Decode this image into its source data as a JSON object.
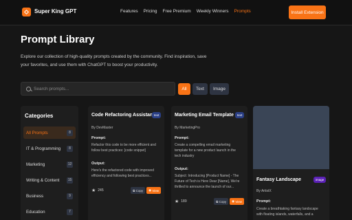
{
  "header": {
    "brand": "Super King GPT",
    "nav": [
      "Features",
      "Pricing",
      "Free Premium",
      "Weekly Winners",
      "Prompts"
    ],
    "active_nav": "Prompts",
    "install_label": "Install Extension"
  },
  "hero": {
    "title": "Prompt Library",
    "description_line1": "Explore our collection of high-quality prompts created by the community. Find inspiration, save",
    "description_line2": "your favorites, and use them with ChatGPT to boost your productivity."
  },
  "search": {
    "placeholder": "Search prompts..."
  },
  "filters": {
    "all": "All",
    "text": "Text",
    "image": "Image"
  },
  "categories": {
    "title": "Categories",
    "items": [
      {
        "label": "All Prompts",
        "count": "8"
      },
      {
        "label": "IT & Programming",
        "count": "8"
      },
      {
        "label": "Marketing",
        "count": "12"
      },
      {
        "label": "Writing & Content",
        "count": "15"
      },
      {
        "label": "Business",
        "count": "9"
      },
      {
        "label": "Education",
        "count": "7"
      }
    ]
  },
  "cards": [
    {
      "title": "Code Refactoring Assistant",
      "badge": "text",
      "author": "By DevMaster",
      "prompt_label": "Prompt:",
      "prompt_l1": "Refactor this code to be more efficient and",
      "prompt_l2": "follow best practices: [code snippet]",
      "output_label": "Output:",
      "output_l1": "Here's the refactored code with improved",
      "output_l2": "efficiency and following best practices...",
      "stars": "245",
      "copy": "Copy",
      "view": "View"
    },
    {
      "title": "Marketing Email Template",
      "badge": "text",
      "author": "By MarketingPro",
      "prompt_label": "Prompt:",
      "prompt_l1": "Create a compelling email marketing",
      "prompt_l2": "template for a new product launch in the",
      "prompt_l3": "tech industry",
      "output_label": "Output:",
      "output_l1": "Subject: Introducing [Product Name] - The",
      "output_l2": "Future of Tech is Here Dear [Name], We're",
      "output_l3": "thrilled to announce the launch of our...",
      "stars": "189",
      "copy": "Copy",
      "view": "View"
    },
    {
      "title": "Fantasy Landscape",
      "badge": "image",
      "author": "By ArtistX",
      "prompt_label": "Prompt:",
      "prompt_l1": "Create a breathtaking fantasy landscape",
      "prompt_l2": "with floating islands, waterfalls, and a"
    }
  ],
  "colors": {
    "accent": "#f97316",
    "background": "#161616",
    "card": "#1e1e1e"
  }
}
